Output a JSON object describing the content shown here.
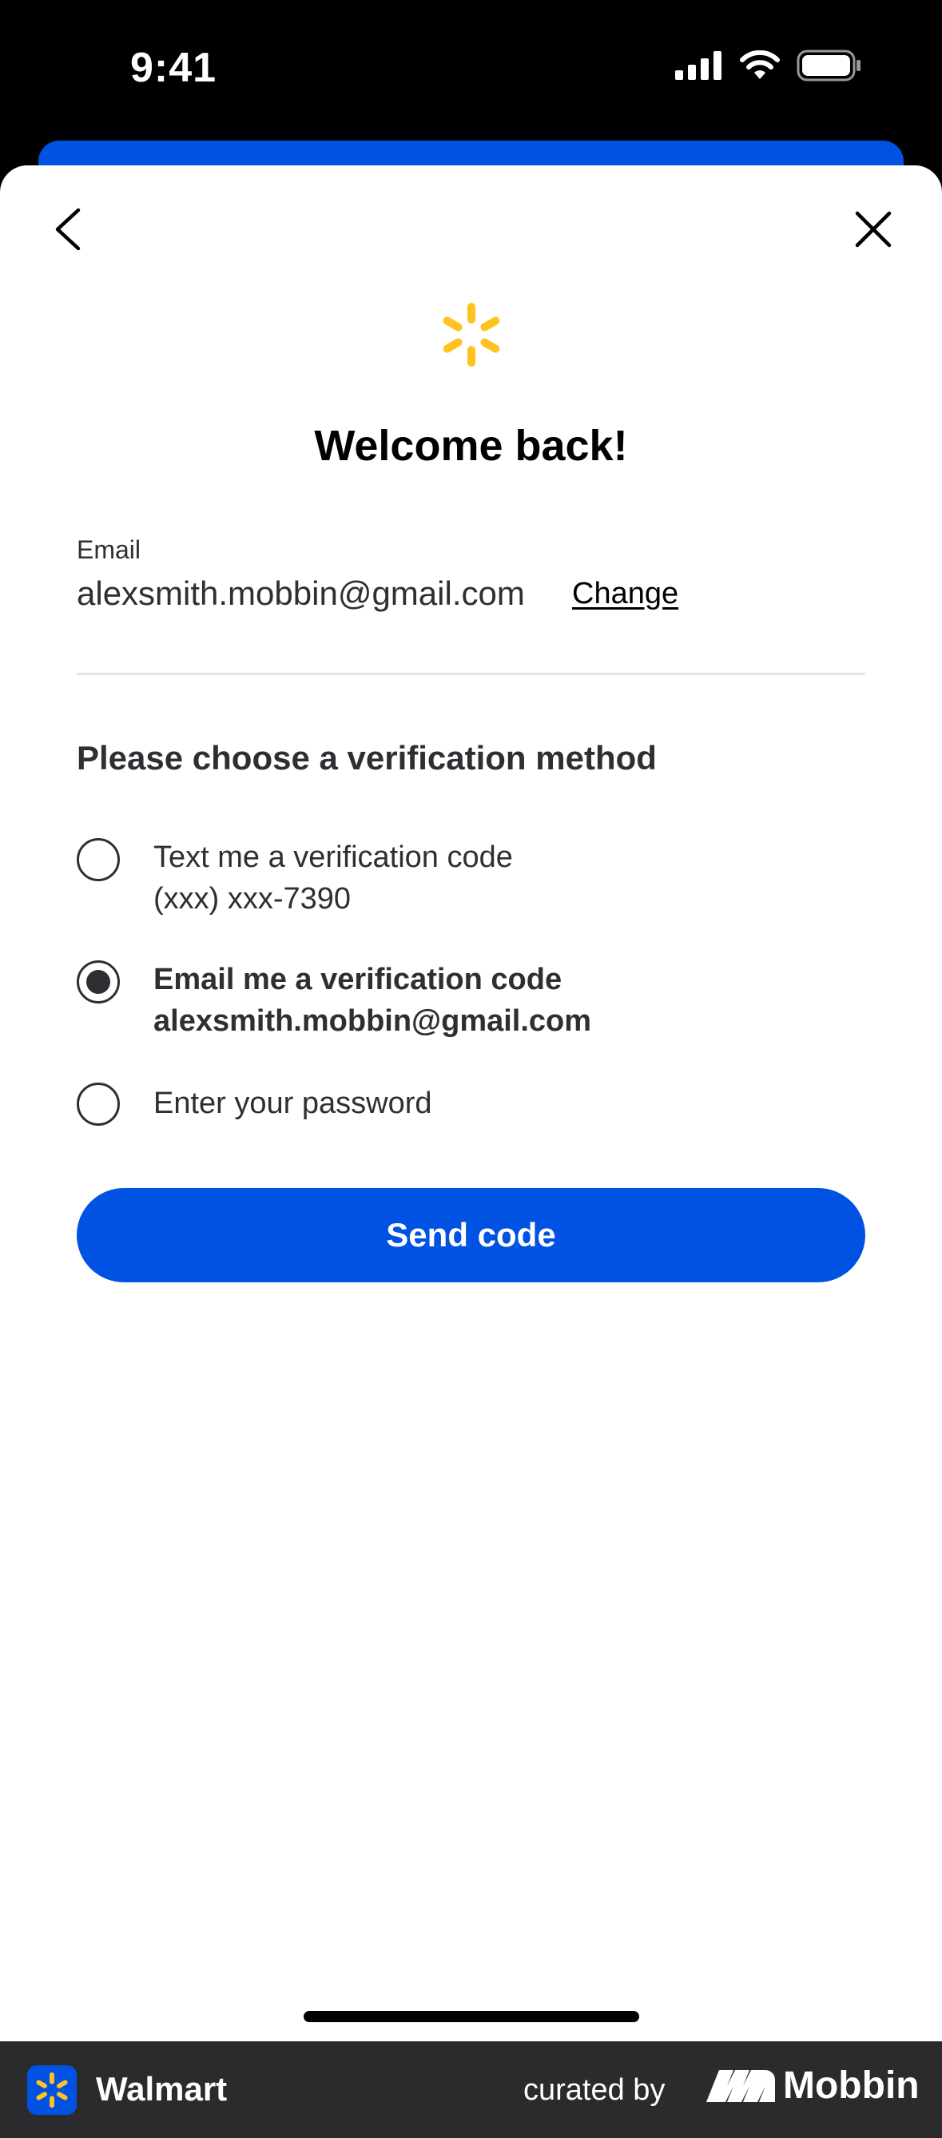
{
  "status_bar": {
    "time": "9:41"
  },
  "header": {
    "back_icon": "chevron-left-icon",
    "close_icon": "close-icon",
    "logo_icon": "walmart-spark-icon",
    "title": "Welcome back!"
  },
  "account": {
    "email_label": "Email",
    "email_value": "alexsmith.mobbin@gmail.com",
    "change_label": "Change"
  },
  "verification": {
    "heading": "Please choose a verification method",
    "options": [
      {
        "line1": "Text me a verification code",
        "line2": "(xxx) xxx-7390",
        "selected": false
      },
      {
        "line1": "Email me a verification code",
        "line2": "alexsmith.mobbin@gmail.com",
        "selected": true
      },
      {
        "line1": "Enter your password",
        "line2": "",
        "selected": false
      }
    ],
    "submit_label": "Send code"
  },
  "footer": {
    "app_name": "Walmart",
    "curated_by": "curated by",
    "brand": "Mobbin"
  },
  "colors": {
    "primary_blue": "#0053e2",
    "spark_yellow": "#ffc220",
    "text_dark": "#2e2f32",
    "footer_bg": "#2b2b2d"
  }
}
